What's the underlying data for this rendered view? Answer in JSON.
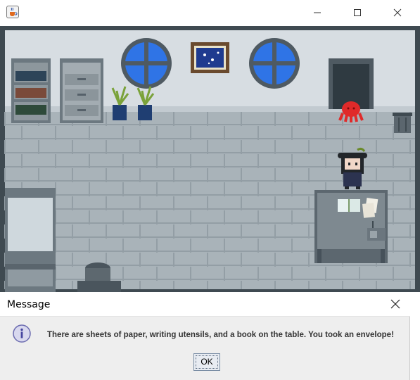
{
  "window": {
    "app_icon": "java-cup-icon",
    "controls": [
      "minimize-icon",
      "maximize-icon",
      "close-icon"
    ]
  },
  "dialog": {
    "title": "Message",
    "icon": "info-icon",
    "message": "There are sheets of paper, writing utensils, and a book on the table. You took an envelope!",
    "ok_label": "OK"
  },
  "colors": {
    "wall": "#d7dde2",
    "floor": "#a9b3b9",
    "window_glass": "#2f74e6",
    "octopus": "#e02a2a"
  }
}
